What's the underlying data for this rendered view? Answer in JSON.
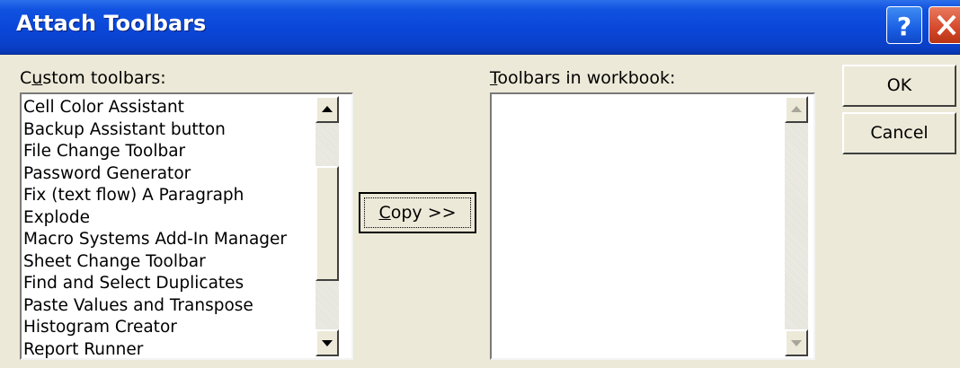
{
  "window": {
    "title": "Attach Toolbars",
    "help_icon": "help-question-icon",
    "close_icon": "close-x-icon"
  },
  "custom_toolbars": {
    "label_mnemonic": "u",
    "label_prefix": "C",
    "label_suffix": "stom toolbars:",
    "items": [
      "Cell Color Assistant",
      "Backup Assistant button",
      "File Change Toolbar",
      "Password Generator",
      "Fix (text flow) A Paragraph",
      "Explode",
      "Macro Systems Add-In Manager",
      "Sheet Change Toolbar",
      "Find and Select Duplicates",
      "Paste Values and Transpose",
      "Histogram Creator",
      "Report Runner"
    ]
  },
  "workbook_toolbars": {
    "label_mnemonic": "T",
    "label_suffix": "oolbars in workbook:",
    "items": []
  },
  "buttons": {
    "copy_mnemonic": "C",
    "copy_suffix": "opy >>",
    "ok": "OK",
    "cancel": "Cancel"
  }
}
